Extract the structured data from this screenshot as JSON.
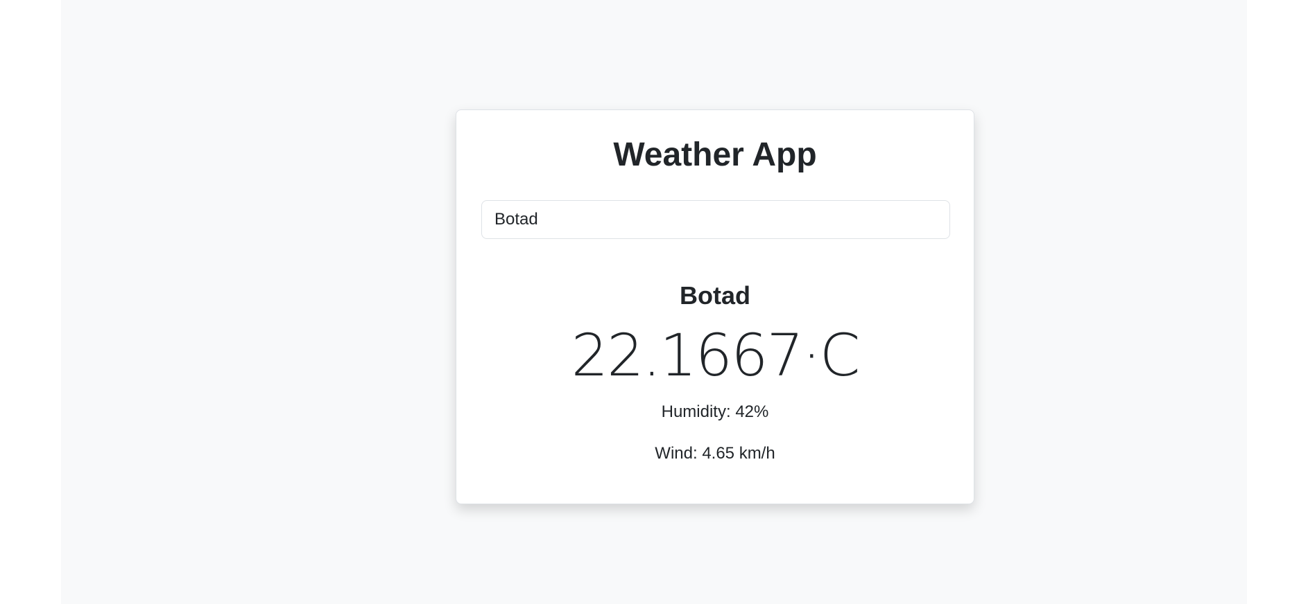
{
  "app": {
    "title": "Weather App"
  },
  "search": {
    "value": "Botad",
    "placeholder": ""
  },
  "weather": {
    "city": "Botad",
    "temperature": "22.1667·C",
    "humidity": "Humidity: 42%",
    "wind": "Wind: 4.65 km/h"
  },
  "colors": {
    "page_background": "#f8f9fa",
    "card_background": "#ffffff",
    "text": "#212529",
    "border": "#dee2e6"
  }
}
